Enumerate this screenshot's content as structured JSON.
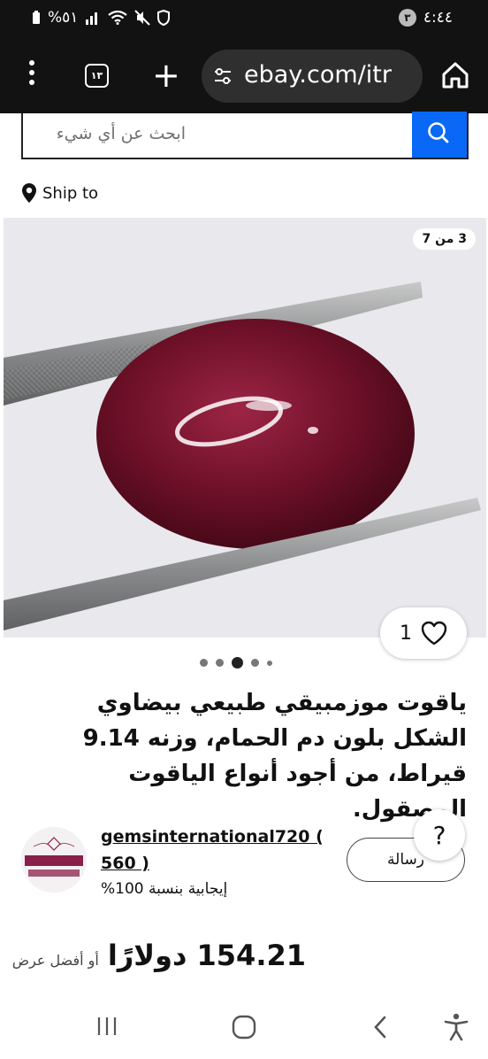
{
  "status_bar": {
    "time": "٤:٤٤",
    "notification_count": "٣",
    "battery": "%٥١"
  },
  "browser": {
    "tab_count": "١٣",
    "url": "ebay.com/itr"
  },
  "search": {
    "placeholder": "ابحث عن أي شيء"
  },
  "ship_to": {
    "label": "Ship to"
  },
  "gallery": {
    "counter": "3 من 7",
    "favorites_count": "1",
    "total_images": 7,
    "current_image": 3
  },
  "listing": {
    "title": "ياقوت موزمبيقي طبيعي بيضاوي الشكل بلون دم الحمام، وزنه 9.14 قيراط، من أجود أنواع الياقوت المصقول."
  },
  "seller": {
    "name": "gemsinternational720 (",
    "score": "560 )",
    "feedback": "إيجابية بنسبة 100%",
    "logo_text": "gemsinternational720",
    "message_label": "رسالة",
    "help_label": "?"
  },
  "price": {
    "amount": "154.21 دولارًا",
    "best_offer": "أو أفضل عرض"
  },
  "colors": {
    "accent": "#0968f6",
    "browser_bg": "#121212",
    "ruby": "#7a1430"
  }
}
